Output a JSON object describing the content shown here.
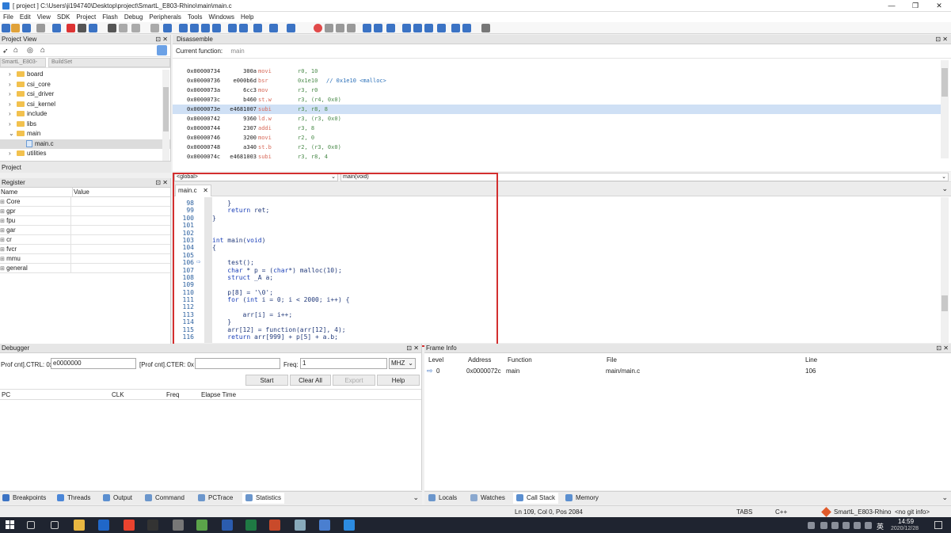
{
  "window": {
    "title": "[ project ] C:\\Users\\ji194740\\Desktop\\project\\SmartL_E803-Rhino\\main\\main.c",
    "min": "—",
    "max": "❐",
    "close": "✕"
  },
  "menu": [
    "File",
    "Edit",
    "View",
    "SDK",
    "Project",
    "Flash",
    "Debug",
    "Peripherals",
    "Tools",
    "Windows",
    "Help"
  ],
  "project_view": {
    "title": "Project View",
    "tabs": [
      "SmartL_E803-",
      "BuildSet"
    ],
    "tree": [
      {
        "label": "board",
        "type": "folder",
        "indent": 1
      },
      {
        "label": "csi_core",
        "type": "folder",
        "indent": 1
      },
      {
        "label": "csi_driver",
        "type": "folder",
        "indent": 1
      },
      {
        "label": "csi_kernel",
        "type": "folder",
        "indent": 1
      },
      {
        "label": "include",
        "type": "folder",
        "indent": 1
      },
      {
        "label": "libs",
        "type": "folder",
        "indent": 1
      },
      {
        "label": "main",
        "type": "folder",
        "indent": 1
      },
      {
        "label": "main.c",
        "type": "file",
        "indent": 2
      },
      {
        "label": "utilities",
        "type": "folder",
        "indent": 1
      }
    ],
    "footer_tab": "Project"
  },
  "register": {
    "title": "Register",
    "col_name": "Name",
    "col_value": "Value",
    "rows": [
      "Core",
      "gpr",
      "fpu",
      "gar",
      "cr",
      "fvcr",
      "mmu",
      "general"
    ]
  },
  "disassemble": {
    "title": "Disassemble",
    "current_function_label": "Current function:",
    "current_function": "main",
    "lines": [
      {
        "addr": "0x00000734",
        "op": "300a",
        "mn": "movi",
        "args": "r0, 10",
        "cmt": ""
      },
      {
        "addr": "0x00000736",
        "op": "e000b6d",
        "mn": "bsr",
        "args": "0x1e10",
        "cmt": "// 0x1e10 <malloc>"
      },
      {
        "addr": "0x0000073a",
        "op": "6cc3",
        "mn": "mov",
        "args": "r3, r0",
        "cmt": ""
      },
      {
        "addr": "0x0000073c",
        "op": "b460",
        "mn": "st.w",
        "args": "r3, (r4, 0x0)",
        "cmt": ""
      },
      {
        "addr": "0x0000073e",
        "op": "e4681007",
        "mn": "subi",
        "args": "r3, r8, 8",
        "cmt": ""
      },
      {
        "addr": "0x00000742",
        "op": "9360",
        "mn": "ld.w",
        "args": "r3, (r3, 0x0)",
        "cmt": ""
      },
      {
        "addr": "0x00000744",
        "op": "2307",
        "mn": "addi",
        "args": "r3, 8",
        "cmt": ""
      },
      {
        "addr": "0x00000746",
        "op": "3200",
        "mn": "movi",
        "args": "r2, 0",
        "cmt": ""
      },
      {
        "addr": "0x00000748",
        "op": "a340",
        "mn": "st.b",
        "args": "r2, (r3, 0x0)",
        "cmt": ""
      },
      {
        "addr": "0x0000074c",
        "op": "e4681003",
        "mn": "subi",
        "args": "r3, r8, 4",
        "cmt": ""
      }
    ],
    "highlight_index": 4
  },
  "editor": {
    "scope_left": "<global>",
    "scope_right": "main(void)",
    "tab": "main.c",
    "tab_close": "✕",
    "lines": [
      {
        "n": "98",
        "t": "    }"
      },
      {
        "n": "99",
        "t": "    return ret;"
      },
      {
        "n": "100",
        "t": "}"
      },
      {
        "n": "101",
        "t": ""
      },
      {
        "n": "102",
        "t": ""
      },
      {
        "n": "103",
        "t": "int main(void)"
      },
      {
        "n": "104",
        "t": "{"
      },
      {
        "n": "105",
        "t": ""
      },
      {
        "n": "106",
        "t": "    test();"
      },
      {
        "n": "107",
        "t": "    char * p = (char*) malloc(10);"
      },
      {
        "n": "108",
        "t": "    struct _A a;"
      },
      {
        "n": "109",
        "t": ""
      },
      {
        "n": "110",
        "t": "    p[8] = '\\0';"
      },
      {
        "n": "111",
        "t": "    for (int i = 0; i < 2000; i++) {"
      },
      {
        "n": "112",
        "t": ""
      },
      {
        "n": "113",
        "t": "        arr[i] = i++;"
      },
      {
        "n": "114",
        "t": "    }"
      },
      {
        "n": "115",
        "t": "    arr[12] = function(arr[12], 4);"
      },
      {
        "n": "116",
        "t": "    return arr[999] + p[5] + a.b;"
      }
    ],
    "current_line_index": 8,
    "annotation_color": "#d32f2f"
  },
  "debugger": {
    "title": "Debugger",
    "ctrl_label": "Prof cnt].CTRL: 0x",
    "ctrl_value": "e0000000",
    "cter_label": "[Prof cnt].CTER: 0x",
    "cter_value": "",
    "freq_label": "Freq:",
    "freq_value": "1",
    "unit": "MHZ",
    "buttons": {
      "start": "Start",
      "clear": "Clear All",
      "export": "Export",
      "help": "Help"
    },
    "columns": [
      "PC",
      "CLK",
      "Freq",
      "Elapse Time"
    ]
  },
  "frame_info": {
    "title": "Frame Info",
    "columns": [
      "Level",
      "Address",
      "Function",
      "File",
      "Line"
    ],
    "rows": [
      {
        "level": "0",
        "address": "0x0000072c",
        "function": "main",
        "file": "main/main.c",
        "line": "106"
      }
    ]
  },
  "bottom_tabs_left": [
    {
      "label": "Breakpoints",
      "color": "#3b73c4"
    },
    {
      "label": "Threads",
      "color": "#4a86d8"
    },
    {
      "label": "Output",
      "color": "#5b8fd0"
    },
    {
      "label": "Command",
      "color": "#6b96cc"
    },
    {
      "label": "PCTrace",
      "color": "#6b96cc"
    },
    {
      "label": "Statistics",
      "color": "#6b96cc"
    }
  ],
  "bottom_tabs_right": [
    {
      "label": "Locals",
      "color": "#6b96cc"
    },
    {
      "label": "Watches",
      "color": "#8aa8cf"
    },
    {
      "label": "Call Stack",
      "color": "#5b8fd0"
    },
    {
      "label": "Memory",
      "color": "#5b8fd0"
    }
  ],
  "statusbar": {
    "position": "Ln 109, Col 0, Pos 2084",
    "tabs": "TABS",
    "lang": "C++",
    "project": "SmartL_E803-Rhino",
    "git": "<no git info>"
  },
  "taskbar": {
    "time": "14:59",
    "date": "2020/12/28",
    "ime": "英"
  }
}
